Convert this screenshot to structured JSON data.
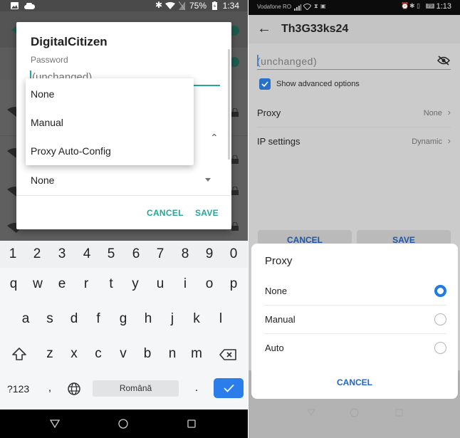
{
  "left": {
    "status_bar": {
      "battery_percent": "75%",
      "time": "1:34",
      "icons": [
        "image-icon",
        "cloud-icon",
        "bluetooth-icon",
        "wifi-icon",
        "no-sim-icon",
        "battery-icon"
      ]
    },
    "dialog": {
      "title": "DigitalCitizen",
      "password_label": "Password",
      "password_placeholder": "(unchanged)",
      "proxy_selected": "None",
      "cancel_label": "CANCEL",
      "save_label": "SAVE",
      "accent_color": "#26a69a"
    },
    "proxy_menu": {
      "options": [
        "None",
        "Manual",
        "Proxy Auto-Config"
      ]
    },
    "keyboard": {
      "number_row": [
        "1",
        "2",
        "3",
        "4",
        "5",
        "6",
        "7",
        "8",
        "9",
        "0"
      ],
      "row1": [
        "q",
        "w",
        "e",
        "r",
        "t",
        "y",
        "u",
        "i",
        "o",
        "p"
      ],
      "row2": [
        "a",
        "s",
        "d",
        "f",
        "g",
        "h",
        "j",
        "k",
        "l"
      ],
      "row3": [
        "z",
        "x",
        "c",
        "v",
        "b",
        "n",
        "m"
      ],
      "symbols_label": "?123",
      "comma": ",",
      "space_label": "Română",
      "period": ".",
      "enter_color": "#2b7de9"
    }
  },
  "right": {
    "status_bar": {
      "carrier": "Vodafone RO",
      "battery": "79",
      "time": "1:13"
    },
    "header": {
      "title": "Th3G33ks24"
    },
    "password_placeholder": "(unchanged)",
    "show_advanced_label": "Show advanced options",
    "show_advanced_checked": true,
    "rows": [
      {
        "label": "Proxy",
        "value": "None"
      },
      {
        "label": "IP settings",
        "value": "Dynamic"
      }
    ],
    "cancel_label": "CANCEL",
    "save_label": "SAVE",
    "proxy_sheet": {
      "title": "Proxy",
      "options": [
        {
          "label": "None",
          "selected": true
        },
        {
          "label": "Manual",
          "selected": false
        },
        {
          "label": "Auto",
          "selected": false
        }
      ],
      "cancel_label": "CANCEL",
      "accent_color": "#1e7be6"
    }
  }
}
